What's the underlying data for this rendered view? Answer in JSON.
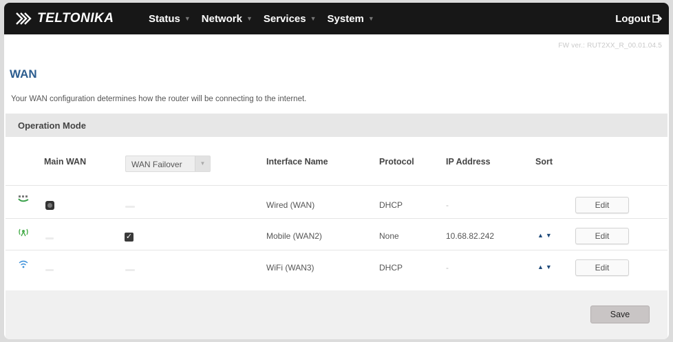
{
  "navbar": {
    "logo_text": "TELTONIKA",
    "menu": [
      {
        "label": "Status"
      },
      {
        "label": "Network"
      },
      {
        "label": "Services"
      },
      {
        "label": "System"
      }
    ],
    "logout_label": "Logout"
  },
  "fw_version": "FW ver.: RUT2XX_R_00.01.04.5",
  "page": {
    "title": "WAN",
    "description": "Your WAN configuration determines how the router will be connecting to the internet."
  },
  "section": {
    "title": "Operation Mode"
  },
  "table": {
    "headers": {
      "main_wan": "Main WAN",
      "interface_name": "Interface Name",
      "protocol": "Protocol",
      "ip_address": "IP Address",
      "sort": "Sort"
    },
    "failover_select": {
      "value": "WAN Failover"
    },
    "rows": [
      {
        "type_icon": "ethernet-icon",
        "interface": "Wired (WAN)",
        "protocol": "DHCP",
        "ip": "-",
        "main_wan_selected": true,
        "failover_checked": false,
        "edit_label": "Edit"
      },
      {
        "type_icon": "mobile-signal-icon",
        "interface": "Mobile (WAN2)",
        "protocol": "None",
        "ip": "10.68.82.242",
        "main_wan_selected": false,
        "failover_checked": true,
        "edit_label": "Edit"
      },
      {
        "type_icon": "wifi-icon",
        "interface": "WiFi (WAN3)",
        "protocol": "DHCP",
        "ip": "-",
        "main_wan_selected": false,
        "failover_checked": false,
        "edit_label": "Edit"
      }
    ]
  },
  "footer": {
    "save_label": "Save"
  },
  "colors": {
    "navbar_bg": "#171717",
    "title_blue": "#2c5d8f",
    "section_bg": "#e7e7e7",
    "sort_arrow": "#1f4a7a"
  }
}
